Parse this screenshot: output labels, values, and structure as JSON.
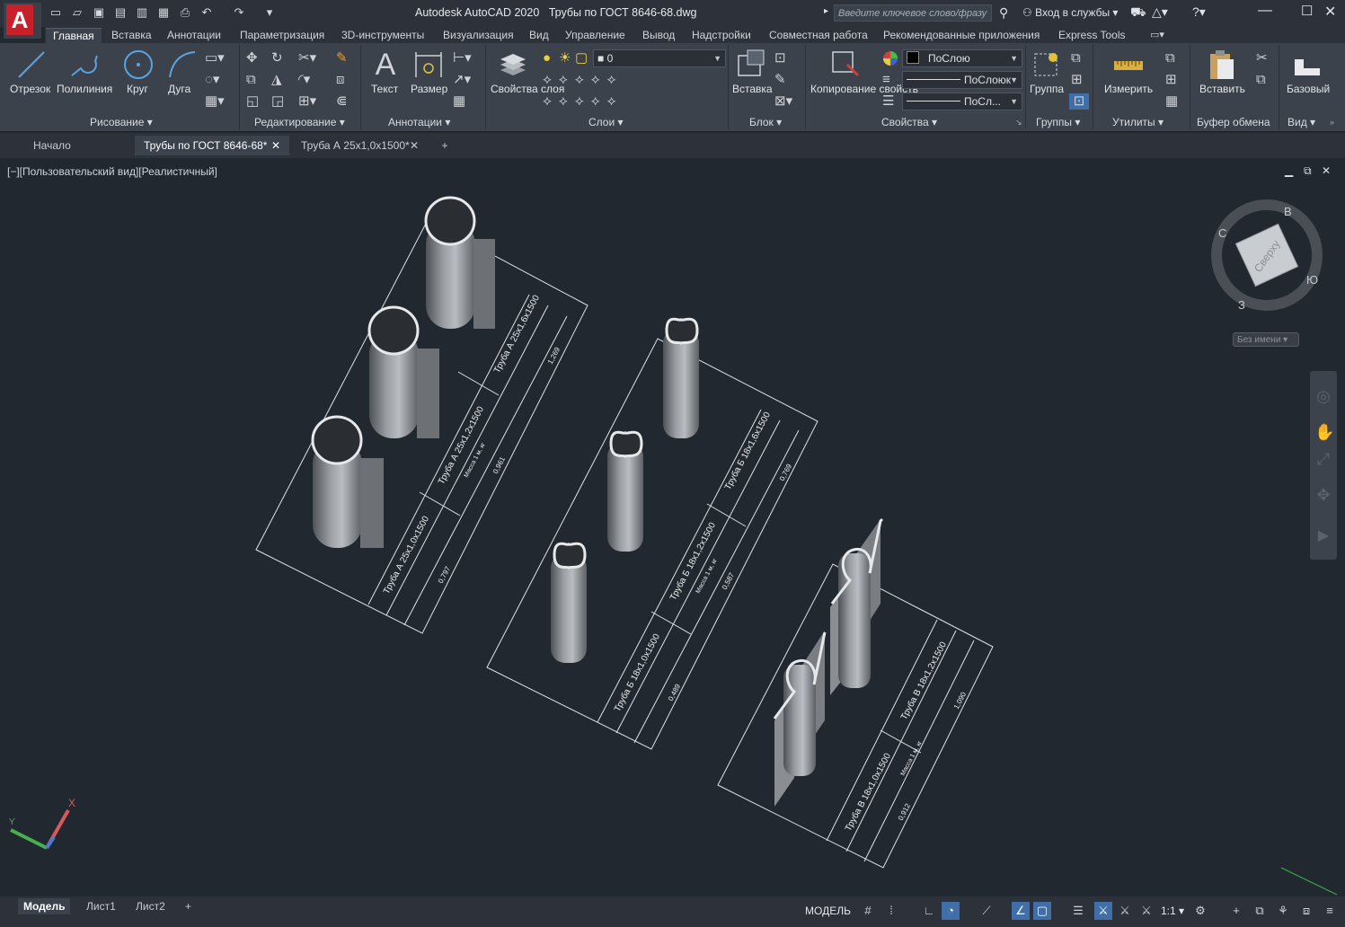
{
  "app": {
    "title": "Autodesk AutoCAD 2020",
    "file": "Трубы по ГОСТ 8646-68.dwg",
    "search_placeholder": "Введите ключевое слово/фразу",
    "signin": "Вход в службы"
  },
  "ribbon_tabs": [
    "Главная",
    "Вставка",
    "Аннотации",
    "Параметризация",
    "3D-инструменты",
    "Визуализация",
    "Вид",
    "Управление",
    "Вывод",
    "Надстройки",
    "Совместная работа",
    "Рекомендованные приложения",
    "Express Tools"
  ],
  "ribbon": {
    "draw": {
      "line": "Отрезок",
      "polyline": "Полилиния",
      "circle": "Круг",
      "arc": "Дуга",
      "title": "Рисование"
    },
    "modify": {
      "title": "Редактирование"
    },
    "annotation": {
      "text": "Текст",
      "dimension": "Размер",
      "title": "Аннотации"
    },
    "layers": {
      "properties": "Свойства слоя",
      "current_layer": "0",
      "title": "Слои"
    },
    "block": {
      "insert": "Вставка",
      "title": "Блок"
    },
    "properties": {
      "match": "Копирование свойств",
      "color": "ПоСлою",
      "linetype": "ПоСлоюк",
      "lineweight": "ПоСл...",
      "title": "Свойства"
    },
    "groups": {
      "group": "Группа",
      "title": "Группы"
    },
    "utilities": {
      "measure": "Измерить",
      "title": "Утилиты"
    },
    "clipboard": {
      "paste": "Вставить",
      "title": "Буфер обмена"
    },
    "view": {
      "base": "Базовый",
      "title": "Вид"
    }
  },
  "doc_tabs": [
    "Начало",
    "Трубы по ГОСТ 8646-68*",
    "Труба А 25x1,0x1500*"
  ],
  "viewport": {
    "label": "[−][Пользовательский вид][Реалистичный]",
    "viewcube_face": "Сверху",
    "compass": {
      "n": "С",
      "e": "В",
      "s": "Ю",
      "w": "З"
    },
    "ucs_name": "Без имени"
  },
  "tables": [
    {
      "rows": [
        {
          "name": "Труба А 25x1,0x1500",
          "mass": "0,797"
        },
        {
          "name": "Труба А 25x1,2x1500",
          "mass": "0,961"
        },
        {
          "name": "Труба А 25x1,6x1500",
          "mass": "1,269"
        }
      ],
      "mass_header": "Масса 1 м, кг"
    },
    {
      "rows": [
        {
          "name": "Труба Б 18x1,0x1500",
          "mass": "0,489"
        },
        {
          "name": "Труба Б 18x1,2x1500",
          "mass": "0,587"
        },
        {
          "name": "Труба Б 18x1,6x1500",
          "mass": "0,769"
        }
      ],
      "mass_header": "Масса 1 м, кг"
    },
    {
      "rows": [
        {
          "name": "Труба В 18x1,0x1500",
          "mass": "0,912"
        },
        {
          "name": "Труба В 18x1,2x1500",
          "mass": "1,090"
        }
      ],
      "mass_header": "Масса 1 м, кг"
    }
  ],
  "layout_tabs": [
    "Модель",
    "Лист1",
    "Лист2"
  ],
  "status": {
    "mode": "МОДЕЛЬ",
    "scale": "1:1"
  },
  "colors": {
    "accent": "#3f6ea8",
    "background": "#212830",
    "ribbon": "#3b424c",
    "logo": "#c8202b"
  }
}
